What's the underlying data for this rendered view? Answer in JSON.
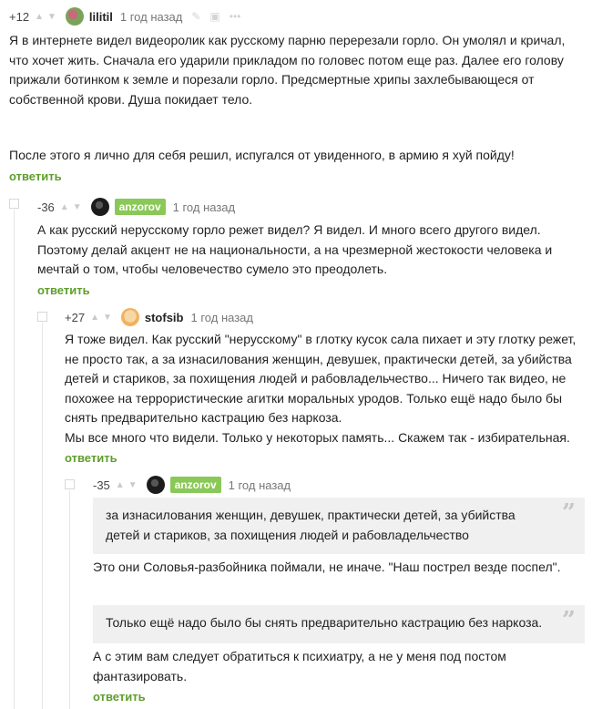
{
  "comments": [
    {
      "rating": "+12",
      "user": "lilitil",
      "time": "1 год назад",
      "paragraphs": [
        "Я в интернете видел видеоролик как русскому парню перерезали горло. Он умолял и кричал, что хочет жить. Сначала его ударили прикладом по головес потом еще раз. Далее его голову прижали ботинком к земле и порезали горло. Предсмертные хрипы захлебывающеся от собственной крови. Душа покидает тело.",
        "После этого я лично для себя решил, испугался от увиденного, в армию я хуй пойду!"
      ],
      "reply": "ответить"
    },
    {
      "rating": "-36",
      "user": "anzorov",
      "time": "1 год назад",
      "paragraphs": [
        "А как русский нерусскому горло режет видел? Я видел. И много всего другого видел. Поэтому делай акцент не на национальности, а на чрезмерной жестокости человека и мечтай о том, чтобы человечество сумело это преодолеть."
      ],
      "reply": "ответить"
    },
    {
      "rating": "+27",
      "user": "stofsib",
      "time": "1 год назад",
      "paragraphs": [
        "Я тоже видел. Как русский \"нерусскому\" в глотку кусок сала пихает и эту глотку режет, не просто так, а за изнасилования женщин, девушек, практически детей, за убийства детей и стариков, за похищения людей и рабовладельчество... Ничего так видео, не похожее на террористические агитки моральных уродов. Только ещё надо было бы снять предварительно кастрацию без наркоза.",
        "Мы все много что видели. Только у некоторых память... Скажем так - избирательная."
      ],
      "reply": "ответить"
    },
    {
      "rating": "-35",
      "user": "anzorov",
      "time": "1 год назад",
      "quote1": "за изнасилования женщин, девушек, практически детей, за убийства детей и стариков, за похищения людей и рабовладельчество",
      "text1": "Это они Соловья-разбойника поймали, не иначе. \"Наш пострел везде поспел\".",
      "quote2": "Только ещё надо было бы снять предварительно кастрацию без наркоза.",
      "text2": "А с этим вам следует обратиться к психиатру, а не у меня под постом фантазировать.",
      "reply": "ответить"
    }
  ],
  "icons": {
    "vote_up": "▲",
    "vote_down": "▼",
    "quote_mark": "”"
  }
}
